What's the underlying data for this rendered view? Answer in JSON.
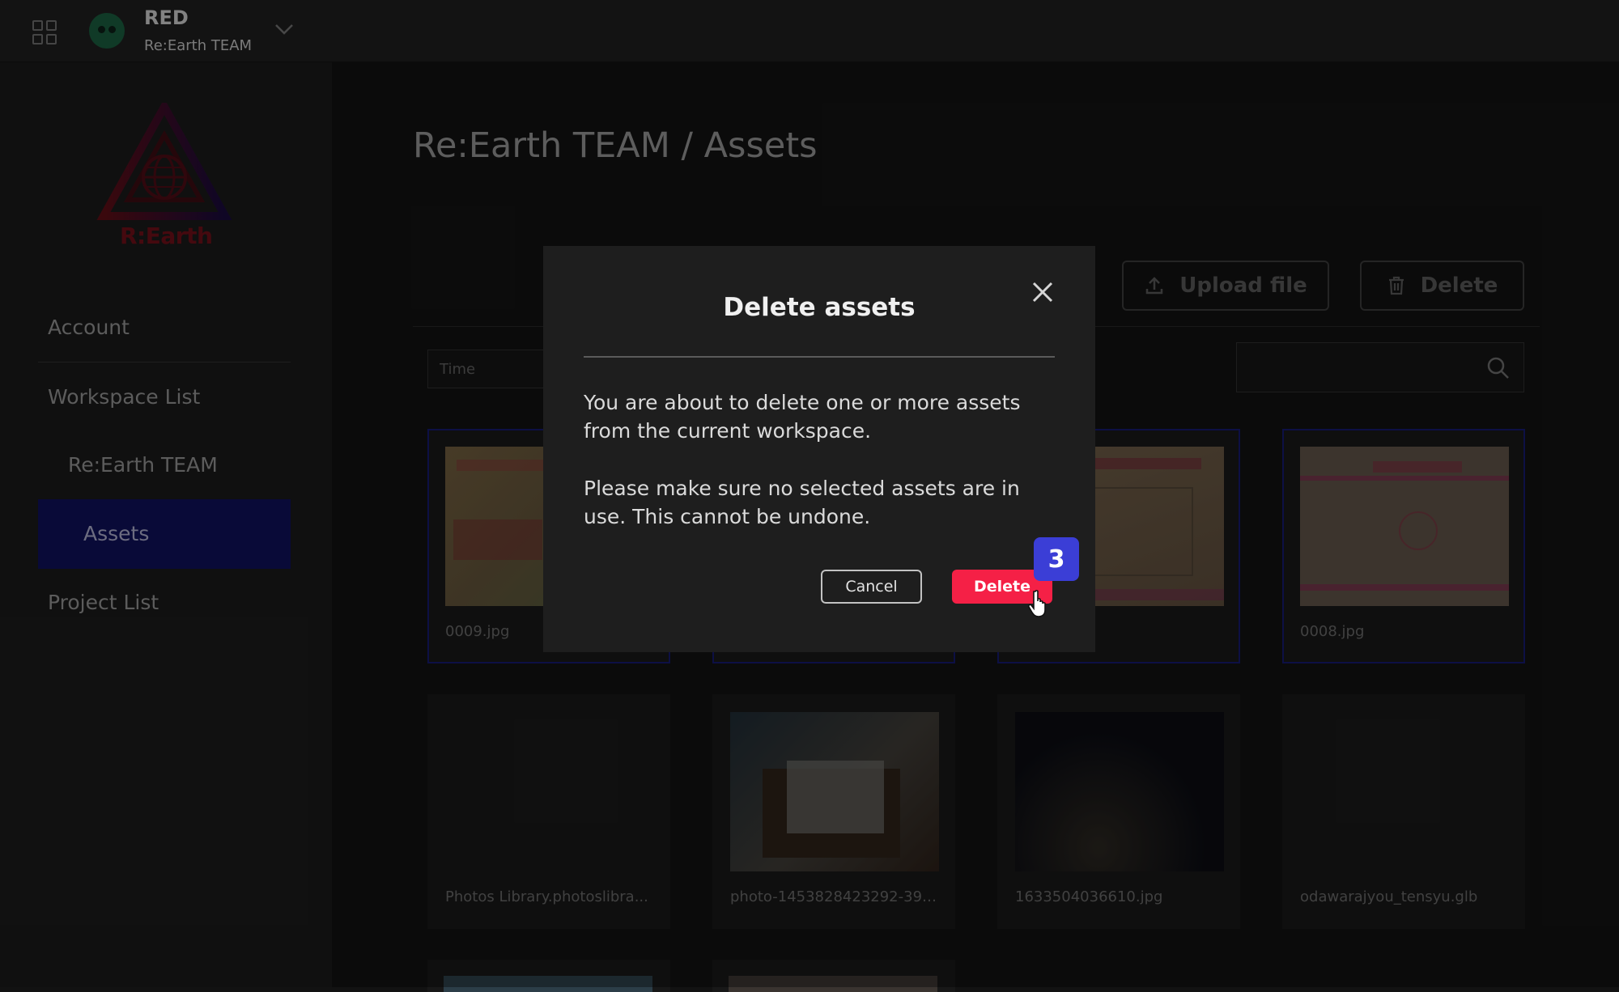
{
  "header": {
    "user_name": "RED",
    "team_name": "Re:Earth TEAM"
  },
  "sidebar": {
    "logo_text": "R:Earth",
    "items": [
      {
        "label": "Account"
      },
      {
        "label": "Workspace List"
      },
      {
        "label": "Re:Earth TEAM"
      },
      {
        "label": "Assets"
      },
      {
        "label": "Project List"
      }
    ]
  },
  "page": {
    "title": "Re:Earth TEAM / Assets"
  },
  "toolbar": {
    "upload_label": "Upload file",
    "delete_label": "Delete",
    "sort_value": "Time",
    "search_placeholder": ""
  },
  "assets": [
    {
      "name": "0009.jpg",
      "selected": true
    },
    {
      "name": "",
      "selected": true
    },
    {
      "name": "",
      "selected": true
    },
    {
      "name": "0008.jpg",
      "selected": true
    },
    {
      "name": "Photos Library.photoslibra...",
      "selected": false
    },
    {
      "name": "photo-1453828423292-392a...",
      "selected": false
    },
    {
      "name": "1633504036610.jpg",
      "selected": false
    },
    {
      "name": "odawarajyou_tensyu.glb",
      "selected": false
    }
  ],
  "modal": {
    "title": "Delete assets",
    "paragraph1": "You are about to delete one or more assets from the current workspace.",
    "paragraph2": "Please make sure no selected assets are in use. This cannot be undone.",
    "cancel_label": "Cancel",
    "delete_label": "Delete"
  },
  "annotation": {
    "step": "3"
  },
  "colors": {
    "accent": "#3b3ed6",
    "danger": "#f52046",
    "nav_active": "#0f1056",
    "selected_border": "#141a6b"
  },
  "icons": {
    "apps": "apps-grid-icon",
    "team_switch": "chevron-down-icon",
    "upload": "upload-icon",
    "delete": "trash-icon",
    "search": "search-icon",
    "close": "close-icon",
    "cursor": "hand-cursor-icon"
  }
}
